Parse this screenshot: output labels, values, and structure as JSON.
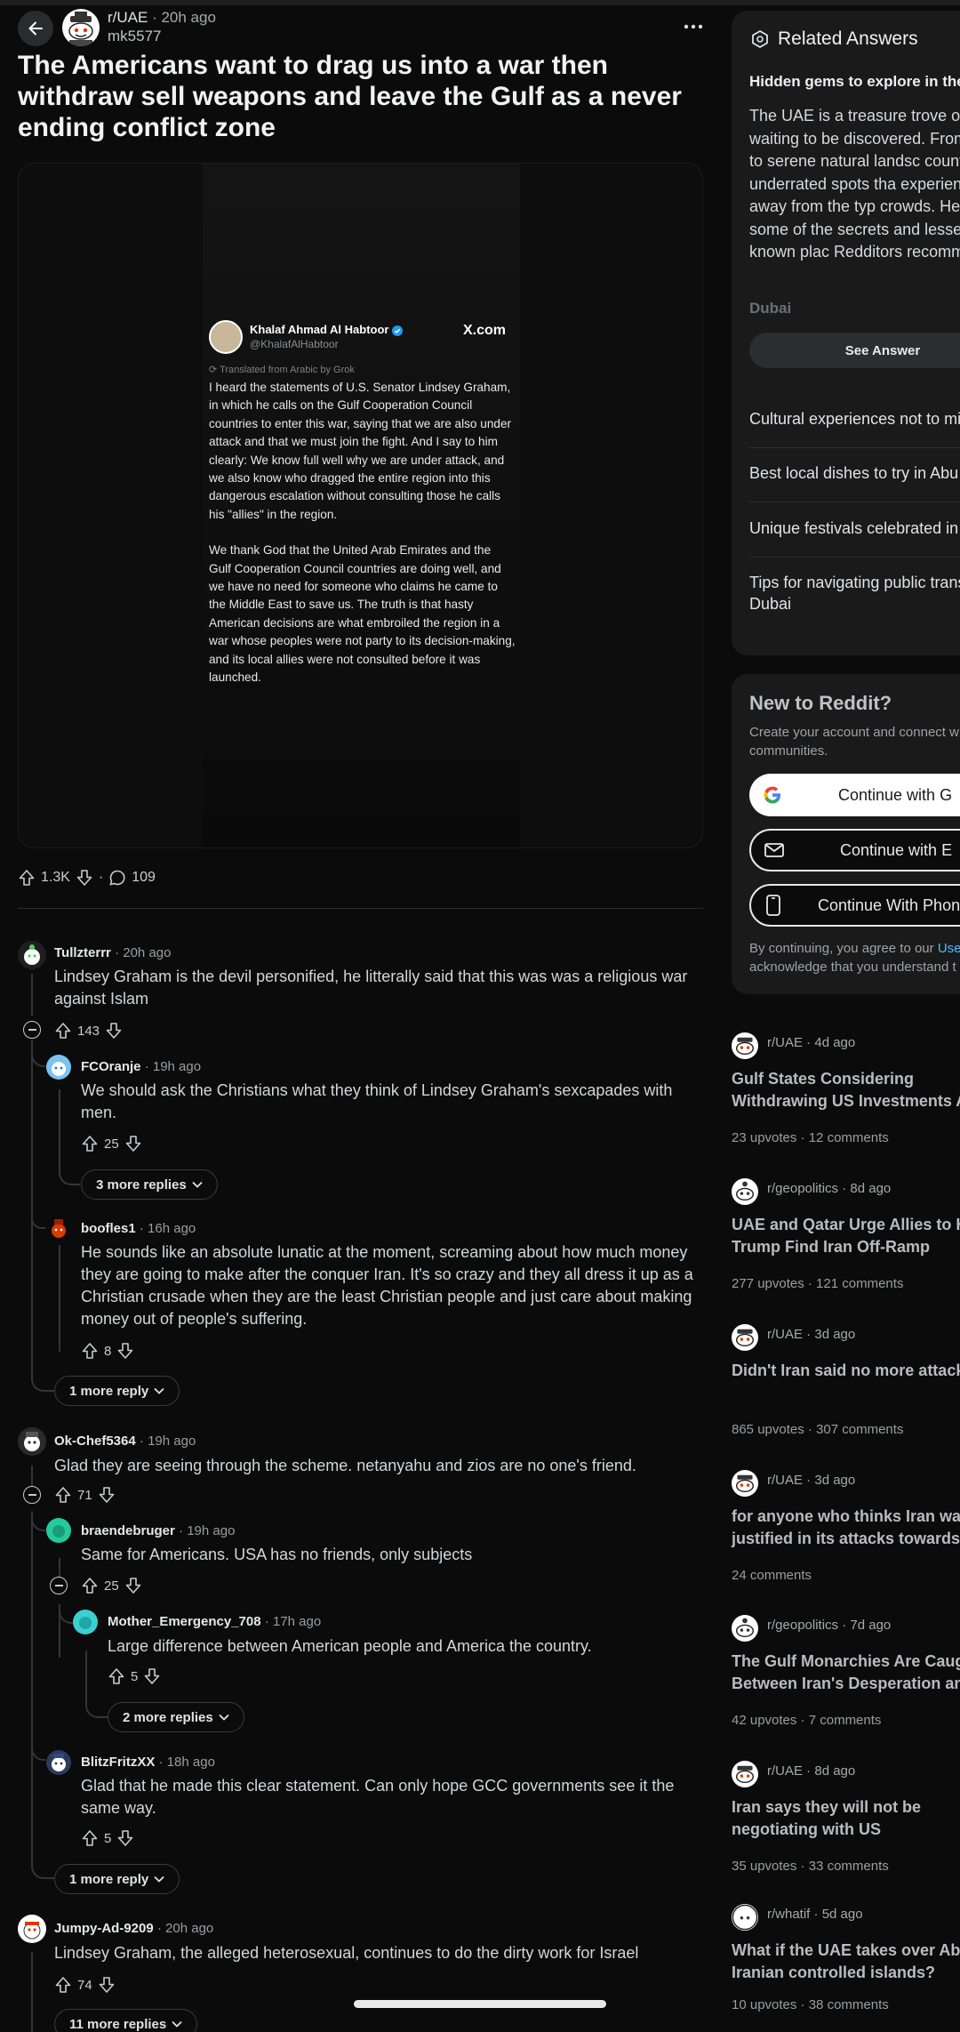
{
  "post": {
    "subreddit": "r/UAE",
    "age": "20h ago",
    "author": "mk5577",
    "title": "The Americans want to drag us into a war then withdraw sell weapons and leave the Gulf as a never ending conflict zone",
    "upvotes": "1.3K",
    "comments": "109"
  },
  "tweet": {
    "name": "Khalaf Ahmad Al Habtoor",
    "handle": "@KhalafAlHabtoor",
    "site": "X.com",
    "translated": "Translated from Arabic by Grok",
    "p1": "I heard the statements of U.S. Senator Lindsey Graham, in which he calls on the Gulf Cooperation Council countries to enter this war, saying that we are also under attack and that we must join the fight. And I say to him clearly: We know full well why we are under attack, and we also know who dragged the entire region into this dangerous escalation without consulting those he calls his \"allies\" in the region.",
    "p2": "We thank God that the United Arab Emirates and the Gulf Cooperation Council countries are doing well, and we have no need for someone who claims he came to the Middle East to save us. The truth is that hasty American decisions are what embroiled the region in a war whose peoples were not party to its decision-making, and its local allies were not consulted before it was launched."
  },
  "comments": [
    {
      "user": "Tullzterrr",
      "age": "20h ago",
      "text": "Lindsey Graham is the devil personified, he litterally said that this was was a religious war against Islam",
      "votes": "143"
    },
    {
      "user": "FCOranje",
      "age": "19h ago",
      "text": "We should ask the Christians what they think of Lindsey Graham's sexcapades with men.",
      "votes": "25",
      "more": "3 more replies"
    },
    {
      "user": "boofles1",
      "age": "16h ago",
      "text": "He sounds like an absolute lunatic at the moment, screaming about how much money they are going to make after the conquer Iran. It's so crazy and they all dress it up as a Christian crusade when they are the least Christian people and just care about making money out of people's suffering.",
      "votes": "8",
      "more": "1 more reply"
    },
    {
      "user": "Ok-Chef5364",
      "age": "19h ago",
      "text": "Glad they are seeing through the scheme. netanyahu and zios are no one's friend.",
      "votes": "71"
    },
    {
      "user": "braendebruger",
      "age": "19h ago",
      "text": "Same for Americans. USA has no friends, only subjects",
      "votes": "25"
    },
    {
      "user": "Mother_Emergency_708",
      "age": "17h ago",
      "text": "Large difference between American people and America the country.",
      "votes": "5",
      "more": "2 more replies"
    },
    {
      "user": "BlitzFritzXX",
      "age": "18h ago",
      "text": "Glad that he made this clear statement. Can only hope GCC governments see it the same way.",
      "votes": "5",
      "more": "1 more reply"
    },
    {
      "user": "Jumpy-Ad-9209",
      "age": "20h ago",
      "text": "Lindsey Graham, the alleged heterosexual, continues to do the dirty work for Israel",
      "votes": "74",
      "more": "11 more replies"
    }
  ],
  "related_answers": {
    "header": "Related Answers",
    "subtitle": "Hidden gems to explore in the",
    "text": "The UAE is a treasure trove of waiting to be discovered. From cafes to serene natural landsc countless underrated spots tha experiences away from the typ crowds. Here are some of the secrets and lesser-known plac Redditors recommend:",
    "faded": "Dubai",
    "see_answer": "See Answer",
    "items": [
      "Cultural experiences not to mis",
      "Best local dishes to try in Abu",
      "Unique festivals celebrated in t",
      "Tips for navigating public trans"
    ],
    "item4_line2": "Dubai"
  },
  "new_to_reddit": {
    "title": "New to Reddit?",
    "line1": "Create your account and connect w",
    "line2": "communities.",
    "google": "Continue with G",
    "email": "Continue with E",
    "phone": "Continue With Phone",
    "legal1": "By continuing, you agree to our",
    "legal_link": "Use",
    "legal2": "acknowledge that you understand t"
  },
  "related_posts": [
    {
      "sub": "r/UAE",
      "age": "4d ago",
      "title": "Gulf States Considering Withdrawing US Investments Am",
      "stats": "23 upvotes · 12 comments"
    },
    {
      "sub": "r/geopolitics",
      "age": "8d ago",
      "title": "UAE and Qatar Urge Allies to Hel Trump Find Iran Off-Ramp",
      "stats": "277 upvotes · 121 comments"
    },
    {
      "sub": "r/UAE",
      "age": "3d ago",
      "title": "Didn't Iran said no more attacking",
      "stats": "865 upvotes · 307 comments"
    },
    {
      "sub": "r/UAE",
      "age": "3d ago",
      "title": "for anyone who thinks Iran was justified in its attacks towards th",
      "stats": "24 comments"
    },
    {
      "sub": "r/geopolitics",
      "age": "7d ago",
      "title": "The Gulf Monarchies Are Caught Between Iran's Desperation and t",
      "stats": "42 upvotes · 7 comments"
    },
    {
      "sub": "r/UAE",
      "age": "8d ago",
      "title": "Iran says they will not be negotiating with US",
      "stats": "35 upvotes · 33 comments"
    },
    {
      "sub": "r/whatif",
      "age": "5d ago",
      "title": "What if the UAE takes over Abu M Iranian controlled islands?",
      "stats": "10 upvotes · 38 comments"
    }
  ],
  "colors": {
    "background": "#0b0b0b",
    "panel": "#1a1a1b",
    "link": "#4fbcff",
    "thread": "#343536"
  }
}
